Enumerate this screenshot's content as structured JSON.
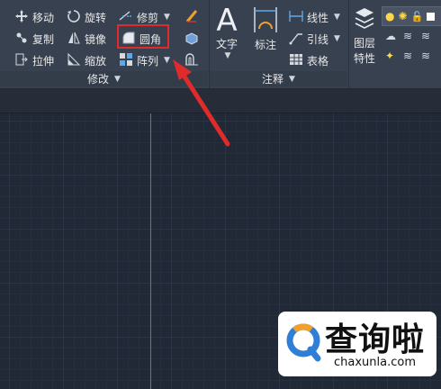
{
  "ribbon": {
    "modify": {
      "move": "移动",
      "rotate": "旋转",
      "trim": "修剪",
      "copy": "复制",
      "mirror": "镜像",
      "fillet": "圆角",
      "stretch": "拉伸",
      "scale": "缩放",
      "array": "阵列",
      "title": "修改"
    },
    "annotation": {
      "text": "文字",
      "dimension": "标注",
      "linear": "线性",
      "leader": "引线",
      "table": "表格",
      "title": "注释"
    },
    "layers": {
      "layer_properties_line1": "图层",
      "layer_properties_line2": "特性"
    }
  },
  "highlight_color": "#e02b2b",
  "watermark": {
    "text": "查询啦",
    "domain": "chaxunla.com"
  }
}
